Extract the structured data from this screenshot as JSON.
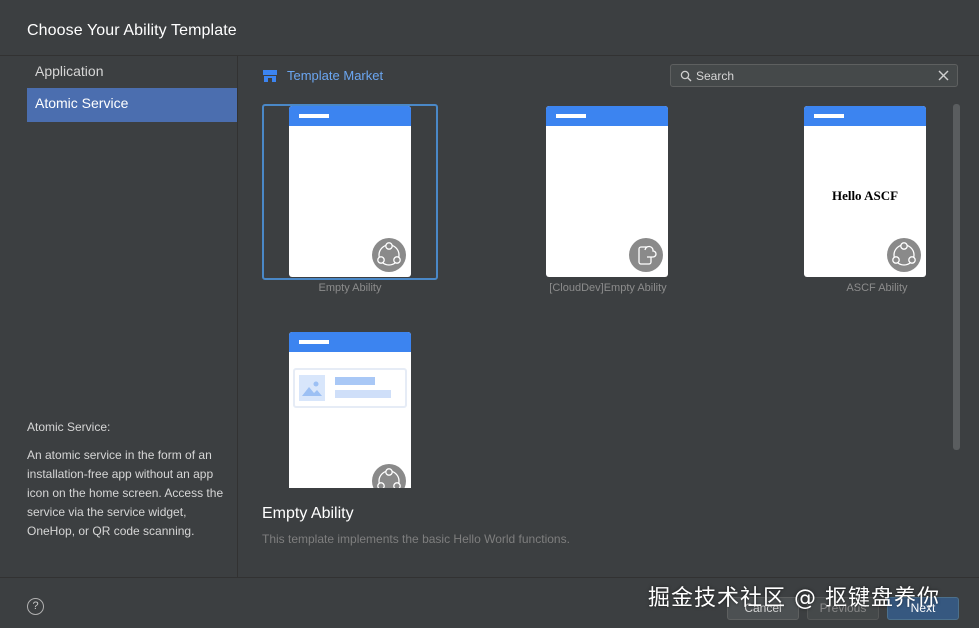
{
  "dialog": {
    "title": "Choose Your Ability Template"
  },
  "sidebar": {
    "items": [
      {
        "label": "Application",
        "selected": false
      },
      {
        "label": "Atomic Service",
        "selected": true
      }
    ],
    "description_title": "Atomic Service:",
    "description_body": "An atomic service in the form of an installation-free app without an app icon on the home screen. Access the service via the service widget, OneHop, or QR code scanning."
  },
  "market": {
    "label": "Template Market",
    "icon": "store-icon"
  },
  "search": {
    "placeholder": "Search",
    "value": ""
  },
  "templates": [
    {
      "label": "Empty Ability",
      "selected": true,
      "badge_icon": "atomic-service-icon"
    },
    {
      "label": "[CloudDev]Empty Ability",
      "selected": false,
      "badge_icon": "cloud-device-icon"
    },
    {
      "label": "ASCF Ability",
      "selected": false,
      "preview_text": "Hello ASCF",
      "badge_icon": "atomic-service-icon"
    },
    {
      "label": "",
      "selected": false,
      "badge_icon": "atomic-service-icon"
    }
  ],
  "detail": {
    "name": "Empty Ability",
    "description": "This template implements the basic Hello World functions."
  },
  "footer": {
    "help_label": "?",
    "cancel_label": "Cancel",
    "previous_label": "Previous",
    "next_label": "Next"
  },
  "watermark": "掘金技术社区 @ 抠键盘养你",
  "colors": {
    "accent": "#4b6eaf",
    "link": "#6ba6f1",
    "phone_bar": "#3c84f0",
    "background": "#3c3f41"
  }
}
